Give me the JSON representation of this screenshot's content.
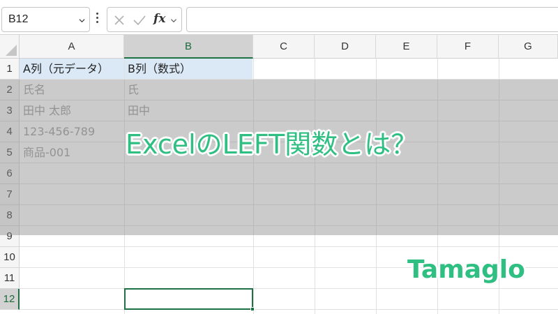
{
  "formula_bar": {
    "name_box": "B12",
    "fx_label": "fx",
    "formula": ""
  },
  "columns": [
    "A",
    "B",
    "C",
    "D",
    "E",
    "F",
    "G"
  ],
  "selected_column": "B",
  "rows": [
    "1",
    "2",
    "3",
    "4",
    "5",
    "6",
    "7",
    "8",
    "9",
    "10",
    "11",
    "12"
  ],
  "selected_row": "12",
  "cells": {
    "a1": "A列（元データ）",
    "b1": "B列（数式）",
    "a2": "氏名",
    "b2": "氏",
    "a3": "田中 太郎",
    "b3": "田中",
    "a4": "123-456-789",
    "a5": "商品-001"
  },
  "overlay": {
    "headline": "ExcelのLEFT関数とは？",
    "brand": "Tamaglo"
  },
  "colors": {
    "accent": "#1e7145",
    "headline": "#2fbf82",
    "header_fill": "#dbe9f7"
  }
}
